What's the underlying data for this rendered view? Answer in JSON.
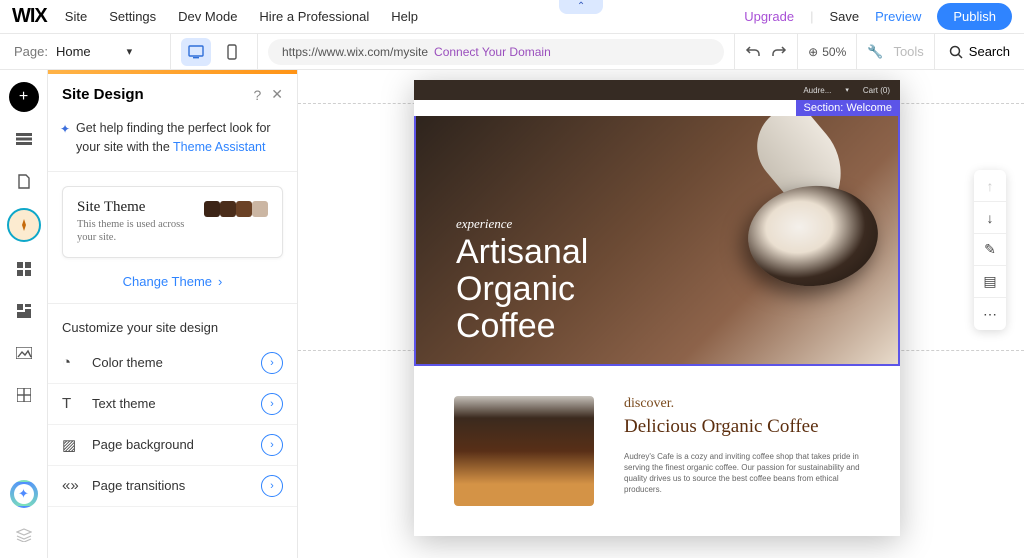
{
  "topmenu": {
    "items": [
      "Site",
      "Settings",
      "Dev Mode",
      "Hire a Professional",
      "Help"
    ]
  },
  "topright": {
    "upgrade": "Upgrade",
    "save": "Save",
    "preview": "Preview",
    "publish": "Publish"
  },
  "toolbar": {
    "page_label": "Page:",
    "page_name": "Home",
    "url": "https://www.wix.com/mysite",
    "connect": "Connect Your Domain",
    "zoom": "50%",
    "tools": "Tools",
    "search": "Search"
  },
  "panel": {
    "title": "Site Design",
    "help_text_a": "Get help finding the perfect look for your site with the ",
    "help_link": "Theme Assistant",
    "theme": {
      "title": "Site Theme",
      "sub": "This theme is used across your site.",
      "swatches": [
        "#3c2416",
        "#4b2d1a",
        "#6b4226",
        "#cbb6a3"
      ]
    },
    "change": "Change Theme",
    "customize_h": "Customize your site design",
    "rows": [
      {
        "label": "Color theme"
      },
      {
        "label": "Text theme"
      },
      {
        "label": "Page background"
      },
      {
        "label": "Page transitions"
      }
    ]
  },
  "canvas": {
    "section_tag": "Section: Welcome",
    "topbar": {
      "name": "Audre...",
      "cart": "Cart (0)"
    },
    "hero": {
      "exp": "experience",
      "line1": "Artisanal",
      "line2": "Organic",
      "line3": "Coffee"
    },
    "section2": {
      "disc": "discover.",
      "title": "Delicious Organic Coffee",
      "body": "Audrey's Cafe is a cozy and inviting coffee shop that takes pride in serving the finest organic coffee. Our passion for sustainability and quality drives us to source the best coffee beans from ethical producers."
    }
  }
}
